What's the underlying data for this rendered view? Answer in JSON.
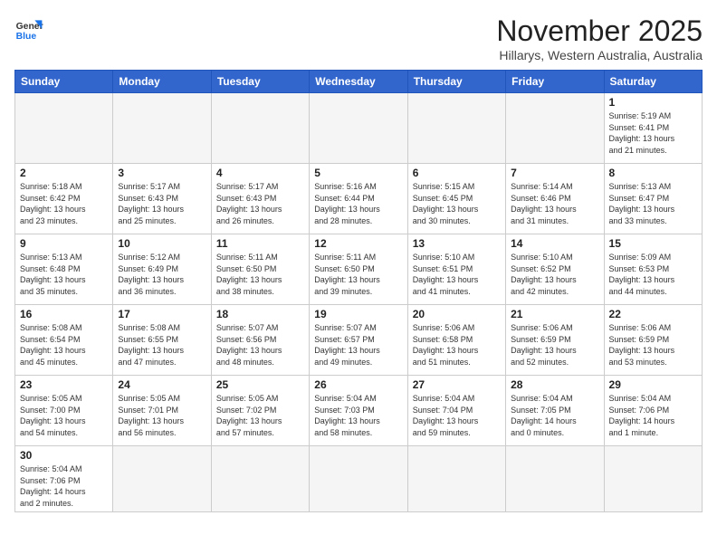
{
  "header": {
    "logo_general": "General",
    "logo_blue": "Blue",
    "month_title": "November 2025",
    "location": "Hillarys, Western Australia, Australia"
  },
  "weekdays": [
    "Sunday",
    "Monday",
    "Tuesday",
    "Wednesday",
    "Thursday",
    "Friday",
    "Saturday"
  ],
  "weeks": [
    [
      {
        "day": "",
        "info": ""
      },
      {
        "day": "",
        "info": ""
      },
      {
        "day": "",
        "info": ""
      },
      {
        "day": "",
        "info": ""
      },
      {
        "day": "",
        "info": ""
      },
      {
        "day": "",
        "info": ""
      },
      {
        "day": "1",
        "info": "Sunrise: 5:19 AM\nSunset: 6:41 PM\nDaylight: 13 hours\nand 21 minutes."
      }
    ],
    [
      {
        "day": "2",
        "info": "Sunrise: 5:18 AM\nSunset: 6:42 PM\nDaylight: 13 hours\nand 23 minutes."
      },
      {
        "day": "3",
        "info": "Sunrise: 5:17 AM\nSunset: 6:43 PM\nDaylight: 13 hours\nand 25 minutes."
      },
      {
        "day": "4",
        "info": "Sunrise: 5:17 AM\nSunset: 6:43 PM\nDaylight: 13 hours\nand 26 minutes."
      },
      {
        "day": "5",
        "info": "Sunrise: 5:16 AM\nSunset: 6:44 PM\nDaylight: 13 hours\nand 28 minutes."
      },
      {
        "day": "6",
        "info": "Sunrise: 5:15 AM\nSunset: 6:45 PM\nDaylight: 13 hours\nand 30 minutes."
      },
      {
        "day": "7",
        "info": "Sunrise: 5:14 AM\nSunset: 6:46 PM\nDaylight: 13 hours\nand 31 minutes."
      },
      {
        "day": "8",
        "info": "Sunrise: 5:13 AM\nSunset: 6:47 PM\nDaylight: 13 hours\nand 33 minutes."
      }
    ],
    [
      {
        "day": "9",
        "info": "Sunrise: 5:13 AM\nSunset: 6:48 PM\nDaylight: 13 hours\nand 35 minutes."
      },
      {
        "day": "10",
        "info": "Sunrise: 5:12 AM\nSunset: 6:49 PM\nDaylight: 13 hours\nand 36 minutes."
      },
      {
        "day": "11",
        "info": "Sunrise: 5:11 AM\nSunset: 6:50 PM\nDaylight: 13 hours\nand 38 minutes."
      },
      {
        "day": "12",
        "info": "Sunrise: 5:11 AM\nSunset: 6:50 PM\nDaylight: 13 hours\nand 39 minutes."
      },
      {
        "day": "13",
        "info": "Sunrise: 5:10 AM\nSunset: 6:51 PM\nDaylight: 13 hours\nand 41 minutes."
      },
      {
        "day": "14",
        "info": "Sunrise: 5:10 AM\nSunset: 6:52 PM\nDaylight: 13 hours\nand 42 minutes."
      },
      {
        "day": "15",
        "info": "Sunrise: 5:09 AM\nSunset: 6:53 PM\nDaylight: 13 hours\nand 44 minutes."
      }
    ],
    [
      {
        "day": "16",
        "info": "Sunrise: 5:08 AM\nSunset: 6:54 PM\nDaylight: 13 hours\nand 45 minutes."
      },
      {
        "day": "17",
        "info": "Sunrise: 5:08 AM\nSunset: 6:55 PM\nDaylight: 13 hours\nand 47 minutes."
      },
      {
        "day": "18",
        "info": "Sunrise: 5:07 AM\nSunset: 6:56 PM\nDaylight: 13 hours\nand 48 minutes."
      },
      {
        "day": "19",
        "info": "Sunrise: 5:07 AM\nSunset: 6:57 PM\nDaylight: 13 hours\nand 49 minutes."
      },
      {
        "day": "20",
        "info": "Sunrise: 5:06 AM\nSunset: 6:58 PM\nDaylight: 13 hours\nand 51 minutes."
      },
      {
        "day": "21",
        "info": "Sunrise: 5:06 AM\nSunset: 6:59 PM\nDaylight: 13 hours\nand 52 minutes."
      },
      {
        "day": "22",
        "info": "Sunrise: 5:06 AM\nSunset: 6:59 PM\nDaylight: 13 hours\nand 53 minutes."
      }
    ],
    [
      {
        "day": "23",
        "info": "Sunrise: 5:05 AM\nSunset: 7:00 PM\nDaylight: 13 hours\nand 54 minutes."
      },
      {
        "day": "24",
        "info": "Sunrise: 5:05 AM\nSunset: 7:01 PM\nDaylight: 13 hours\nand 56 minutes."
      },
      {
        "day": "25",
        "info": "Sunrise: 5:05 AM\nSunset: 7:02 PM\nDaylight: 13 hours\nand 57 minutes."
      },
      {
        "day": "26",
        "info": "Sunrise: 5:04 AM\nSunset: 7:03 PM\nDaylight: 13 hours\nand 58 minutes."
      },
      {
        "day": "27",
        "info": "Sunrise: 5:04 AM\nSunset: 7:04 PM\nDaylight: 13 hours\nand 59 minutes."
      },
      {
        "day": "28",
        "info": "Sunrise: 5:04 AM\nSunset: 7:05 PM\nDaylight: 14 hours\nand 0 minutes."
      },
      {
        "day": "29",
        "info": "Sunrise: 5:04 AM\nSunset: 7:06 PM\nDaylight: 14 hours\nand 1 minute."
      }
    ],
    [
      {
        "day": "30",
        "info": "Sunrise: 5:04 AM\nSunset: 7:06 PM\nDaylight: 14 hours\nand 2 minutes."
      },
      {
        "day": "",
        "info": ""
      },
      {
        "day": "",
        "info": ""
      },
      {
        "day": "",
        "info": ""
      },
      {
        "day": "",
        "info": ""
      },
      {
        "day": "",
        "info": ""
      },
      {
        "day": "",
        "info": ""
      }
    ]
  ]
}
